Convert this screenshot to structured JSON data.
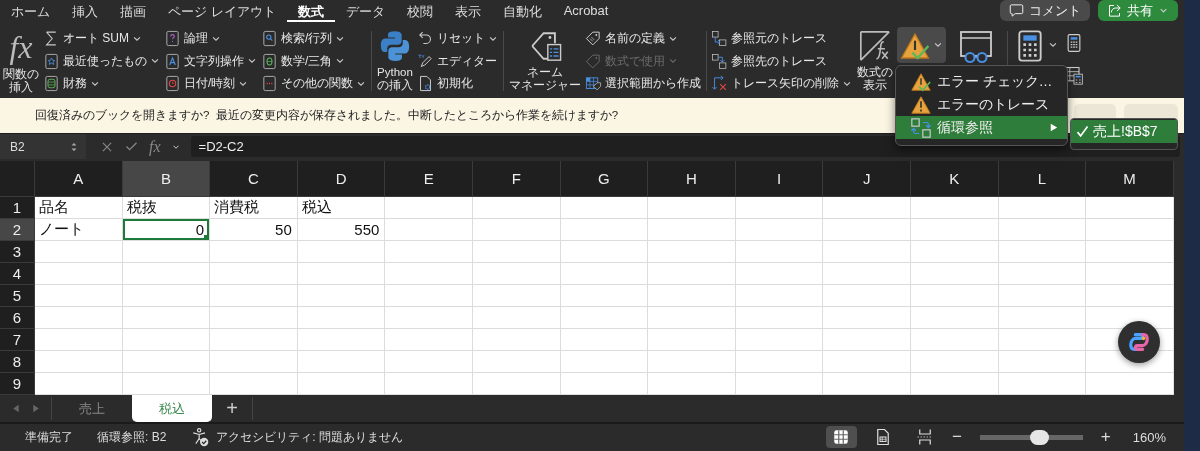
{
  "ribbon_tabs": [
    {
      "label": "ホーム",
      "selected": false
    },
    {
      "label": "挿入",
      "selected": false
    },
    {
      "label": "描画",
      "selected": false
    },
    {
      "label": "ページ レイアウト",
      "selected": false
    },
    {
      "label": "数式",
      "selected": true
    },
    {
      "label": "データ",
      "selected": false
    },
    {
      "label": "校閲",
      "selected": false
    },
    {
      "label": "表示",
      "selected": false
    },
    {
      "label": "自動化",
      "selected": false
    },
    {
      "label": "Acrobat",
      "selected": false
    }
  ],
  "top_buttons": [
    {
      "kind": "comment",
      "label": "コメント"
    },
    {
      "kind": "share",
      "label": "共有"
    }
  ],
  "ribbon": [
    {
      "kind": "large",
      "glyph": "fx",
      "lines": [
        "関数の",
        "挿入"
      ]
    },
    {
      "kind": "column",
      "buttons": [
        {
          "label": "オート SUM",
          "dropdown": true,
          "disabled": false
        },
        {
          "label": "最近使ったもの",
          "dropdown": true,
          "disabled": false
        },
        {
          "label": "財務",
          "dropdown": true,
          "disabled": false
        }
      ]
    },
    {
      "kind": "column",
      "buttons": [
        {
          "label": "論理",
          "dropdown": true,
          "disabled": false
        },
        {
          "label": "文字列操作",
          "dropdown": true,
          "disabled": false
        },
        {
          "label": "日付/時刻",
          "dropdown": true,
          "disabled": false
        }
      ]
    },
    {
      "kind": "column",
      "buttons": [
        {
          "label": "検索/行列",
          "dropdown": true,
          "disabled": false
        },
        {
          "label": "数学/三角",
          "dropdown": true,
          "disabled": false
        },
        {
          "label": "その他の関数",
          "dropdown": true,
          "disabled": false
        }
      ]
    },
    {
      "kind": "separator"
    },
    {
      "kind": "large",
      "lines": [
        "Python",
        "の挿入"
      ]
    },
    {
      "kind": "column",
      "buttons": [
        {
          "label": "リセット",
          "dropdown": true,
          "disabled": false
        },
        {
          "label": "エディター",
          "dropdown": false,
          "disabled": false
        },
        {
          "label": "初期化",
          "dropdown": false,
          "disabled": false
        }
      ]
    },
    {
      "kind": "separator"
    },
    {
      "kind": "large",
      "lines": [
        "ネーム",
        "マネージャー"
      ]
    },
    {
      "kind": "column",
      "buttons": [
        {
          "label": "名前の定義",
          "dropdown": true,
          "disabled": false
        },
        {
          "label": "数式で使用",
          "dropdown": true,
          "disabled": true
        },
        {
          "label": "選択範囲から作成",
          "dropdown": false,
          "disabled": false
        }
      ]
    },
    {
      "kind": "separator"
    },
    {
      "kind": "column",
      "buttons": [
        {
          "label": "参照元のトレース",
          "dropdown": false,
          "disabled": false
        },
        {
          "label": "参照先のトレース",
          "dropdown": false,
          "disabled": false
        },
        {
          "label": "トレース矢印の削除",
          "dropdown": true,
          "disabled": false
        }
      ]
    },
    {
      "kind": "large",
      "lines": [
        "数式の",
        "表示"
      ]
    },
    {
      "kind": "split",
      "pressed": true
    },
    {
      "kind": "icon"
    },
    {
      "kind": "separator"
    },
    {
      "kind": "split",
      "pressed": false
    },
    {
      "kind": "stack"
    }
  ],
  "error_menu": {
    "items": [
      {
        "label": "エラー チェック…",
        "submenu": false,
        "selected": false
      },
      {
        "label": "エラーのトレース",
        "submenu": false,
        "selected": false
      },
      {
        "label": "循環参照",
        "submenu": true,
        "selected": true
      }
    ],
    "submenu": [
      {
        "label": "売上!$B$7",
        "checked": true,
        "selected": true
      }
    ]
  },
  "message_bar": {
    "text": "回復済みのブックを開きますか?  最近の変更内容が保存されました。中断したところから作業を続けますか?"
  },
  "formula_bar": {
    "name_box": "B2",
    "fx": "fx",
    "formula": "=D2-C2"
  },
  "grid": {
    "columns": [
      {
        "label": "A",
        "selected": false
      },
      {
        "label": "B",
        "selected": true
      },
      {
        "label": "C",
        "selected": false
      },
      {
        "label": "D",
        "selected": false
      },
      {
        "label": "E",
        "selected": false
      },
      {
        "label": "F",
        "selected": false
      },
      {
        "label": "G",
        "selected": false
      },
      {
        "label": "H",
        "selected": false
      },
      {
        "label": "I",
        "selected": false
      },
      {
        "label": "J",
        "selected": false
      },
      {
        "label": "K",
        "selected": false
      },
      {
        "label": "L",
        "selected": false
      },
      {
        "label": "M",
        "selected": false
      }
    ],
    "rows": [
      {
        "label": "1",
        "selected": false,
        "cells": [
          {
            "text": "品名",
            "kind": "text",
            "selected": false
          },
          {
            "text": "税抜",
            "kind": "text",
            "selected": false
          },
          {
            "text": "消費税",
            "kind": "text",
            "selected": false
          },
          {
            "text": "税込",
            "kind": "text",
            "selected": false
          }
        ]
      },
      {
        "label": "2",
        "selected": true,
        "cells": [
          {
            "text": "ノート",
            "kind": "text",
            "selected": false
          },
          {
            "text": "0",
            "kind": "number",
            "selected": true
          },
          {
            "text": "50",
            "kind": "number",
            "selected": false
          },
          {
            "text": "550",
            "kind": "number",
            "selected": false
          }
        ]
      },
      {
        "label": "3",
        "selected": false
      },
      {
        "label": "4",
        "selected": false
      },
      {
        "label": "5",
        "selected": false
      },
      {
        "label": "6",
        "selected": false
      },
      {
        "label": "7",
        "selected": false
      },
      {
        "label": "8",
        "selected": false
      },
      {
        "label": "9",
        "selected": false
      }
    ]
  },
  "sheet_tabs": {
    "tabs": [
      {
        "label": "売上",
        "selected": false
      },
      {
        "label": "税込",
        "selected": true
      }
    ],
    "add": "+"
  },
  "status_bar": {
    "ready": "準備完了",
    "circular": "循環参照: B2",
    "accessibility": "アクセシビリティ: 問題ありません",
    "views": [
      {
        "kind": "normal",
        "selected": true
      },
      {
        "kind": "page-layout",
        "selected": false
      },
      {
        "kind": "page-break",
        "selected": false
      }
    ],
    "zoom_minus": "−",
    "zoom": {
      "level": 0.57
    },
    "zoom_plus": "+",
    "zoom_text": "160%"
  }
}
